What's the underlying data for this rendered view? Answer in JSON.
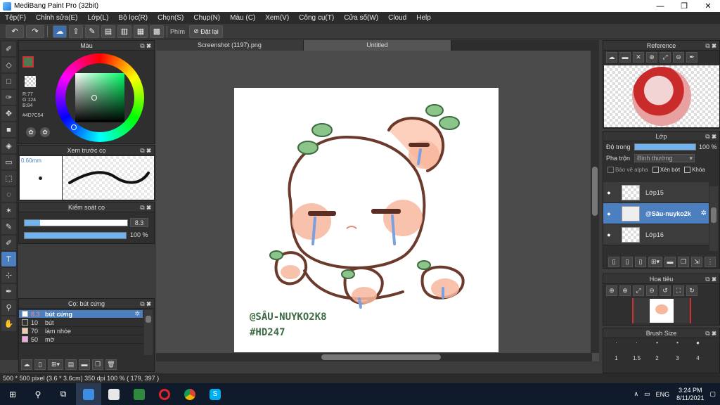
{
  "window": {
    "title": "MediBang Paint Pro (32bit)",
    "minimize": "—",
    "restore": "❐",
    "close": "✕"
  },
  "menu": [
    "Tệp(F)",
    "Chỉnh sửa(E)",
    "Lớp(L)",
    "Bộ lọc(R)",
    "Chọn(S)",
    "Chụp(N)",
    "Màu (C)",
    "Xem(V)",
    "Công cụ(T)",
    "Cửa số(W)",
    "Cloud",
    "Help"
  ],
  "toolbar": {
    "phim_label": "Phím",
    "reset_label": "Đặt lại"
  },
  "color_panel": {
    "title": "Màu",
    "r": "R:77",
    "g": "G:124",
    "b": "B:84",
    "hex": "#4D7C54",
    "main_color": "#4D7C54"
  },
  "brush_preview": {
    "title": "Xem trước cọ",
    "size": "0.60mm"
  },
  "brush_control": {
    "title": "Kiểm soát cọ",
    "size_value": "8.3",
    "opacity_value": "100 %"
  },
  "brush_list": {
    "title": "Cọ: bút cứng",
    "items": [
      {
        "size": "8.3",
        "name": "bút cứng",
        "color": "#ffffff",
        "selected": true
      },
      {
        "size": "10",
        "name": "bút",
        "color": "#333333",
        "selected": false
      },
      {
        "size": "70",
        "name": "làm nhòe",
        "color": "#f3c9a8",
        "selected": false
      },
      {
        "size": "50",
        "name": "mờ",
        "color": "#f4a6e0",
        "selected": false
      }
    ]
  },
  "tabs": [
    {
      "label": "Screenshot (1197).png",
      "active": false
    },
    {
      "label": "Untitled",
      "active": true
    }
  ],
  "artwork": {
    "watermark_line1": "@SÂU-NUYKO2K8",
    "watermark_line2": "#HD247"
  },
  "reference_panel": {
    "title": "Reference"
  },
  "layer_panel": {
    "title": "Lớp",
    "opacity_label": "Độ trong",
    "opacity_value": "100 %",
    "blend_label": "Pha trộn",
    "blend_value": "Bình thường",
    "protect_alpha": "Bảo vệ alpha",
    "clipping": "Xén bớt",
    "lock": "Khóa",
    "layers": [
      {
        "name": "Lớp15",
        "selected": false
      },
      {
        "name": "@Sâu-nuyko2k",
        "selected": true
      },
      {
        "name": "Lớp16",
        "selected": false
      }
    ]
  },
  "navigator_panel": {
    "title": "Hoa tiêu"
  },
  "brush_size_panel": {
    "title": "Brush Size",
    "sizes": [
      "1",
      "1.5",
      "2",
      "3",
      "4"
    ]
  },
  "status": {
    "text": "500 * 500 pixel   (3.6 * 3.6cm)   350 dpi   100 %   ( 179, 397 )"
  },
  "taskbar": {
    "time": "3:24 PM",
    "date": "8/11/2021",
    "lang": "ENG"
  }
}
